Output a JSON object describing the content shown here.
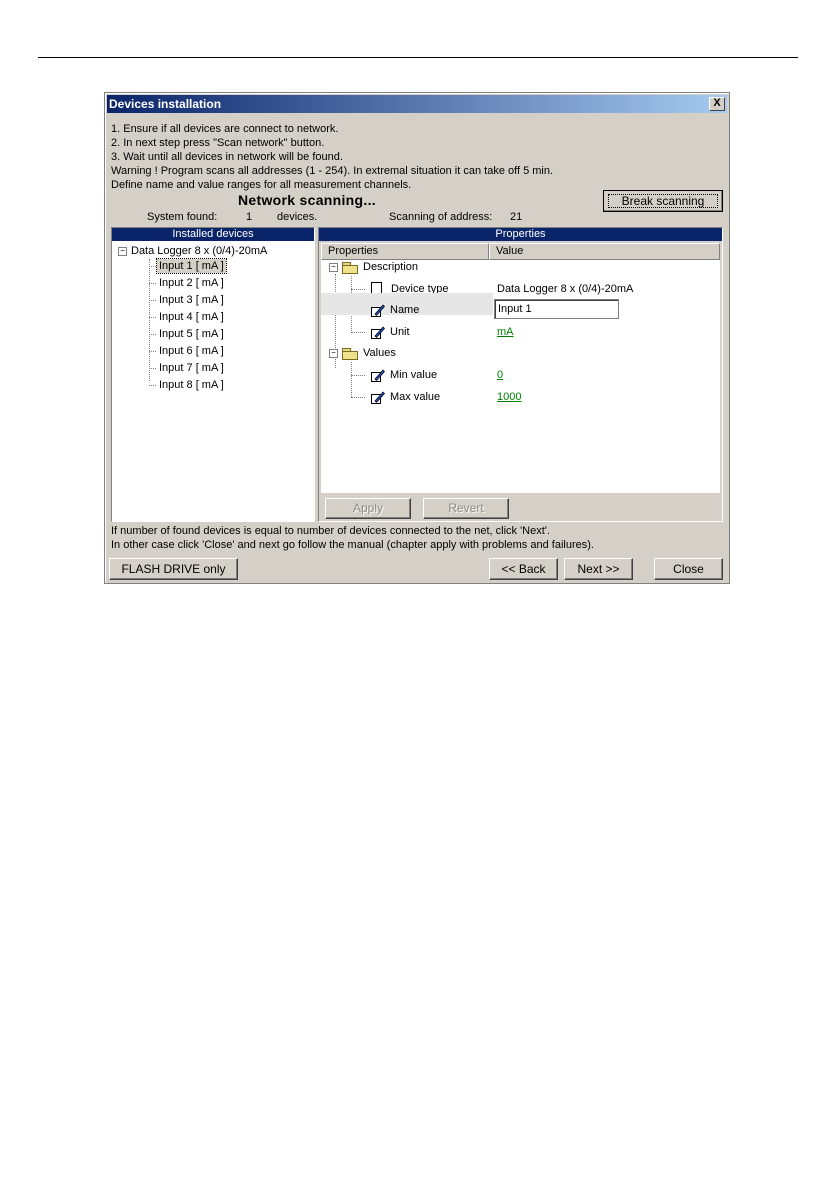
{
  "window": {
    "title": "Devices installation",
    "close_label": "X"
  },
  "instructions": [
    "1. Ensure if all devices are connect to network.",
    "2. In next step press \"Scan network\" button.",
    "3. Wait until all devices in network will be found.",
    "Warning ! Program scans all addresses (1 - 254). In extremal situation it can take off 5 min.",
    "Define name and value ranges for all measurement channels."
  ],
  "scan_status": "Network scanning...",
  "break_button_label": "Break scanning",
  "system_found": {
    "label": "System found:",
    "count": "1",
    "unit": "devices.",
    "scanning_label": "Scanning of address:",
    "address": "21"
  },
  "installed": {
    "header": "Installed devices",
    "root_label": "Data Logger 8 x (0/4)-20mA",
    "items": [
      "Input 1 [ mA ]",
      "Input 2 [ mA ]",
      "Input 3 [ mA ]",
      "Input 4 [ mA ]",
      "Input 5 [ mA ]",
      "Input 6 [ mA ]",
      "Input 7 [ mA ]",
      "Input 8 [ mA ]"
    ]
  },
  "properties": {
    "header": "Properties",
    "col_properties": "Properties",
    "col_value": "Value",
    "description_group": "Description",
    "device_type_label": "Device type",
    "device_type_value": "Data Logger 8 x (0/4)-20mA",
    "name_label": "Name",
    "name_value": "Input 1",
    "unit_label": "Unit",
    "unit_value": "mA",
    "values_group": "Values",
    "min_label": "Min value",
    "min_value": "0",
    "max_label": "Max value",
    "max_value": "1000",
    "apply_label": "Apply",
    "revert_label": "Revert"
  },
  "footer": {
    "line1": "If number of found devices is equal to number of devices connected to the net, click 'Next'.",
    "line2": "In other case click 'Close' and next go follow the manual (chapter apply with problems and failures).",
    "flash_label": "FLASH DRIVE only",
    "back_label": "<< Back",
    "next_label": "Next >>",
    "close_label": "Close"
  }
}
